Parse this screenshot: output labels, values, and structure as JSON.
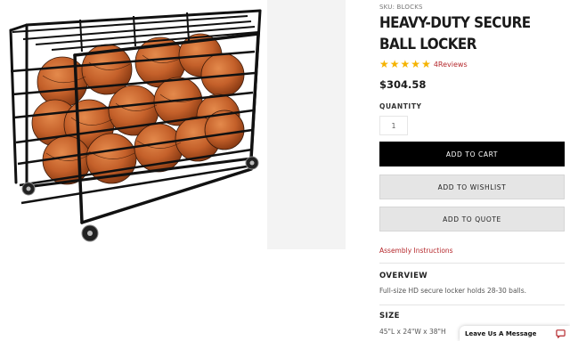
{
  "product": {
    "sku_label": "SKU: BLOCKS",
    "title": "HEAVY-DUTY SECURE BALL LOCKER",
    "rating_stars": 5,
    "reviews_label": "4Reviews",
    "price": "$304.58",
    "quantity_label": "QUANTITY",
    "quantity_value": "1"
  },
  "actions": {
    "add_to_cart": "ADD TO CART",
    "add_to_wishlist": "ADD TO WISHLIST",
    "add_to_quote": "ADD TO QUOTE"
  },
  "links": {
    "assembly": "Assembly Instructions"
  },
  "overview": {
    "heading": "OVERVIEW",
    "text": "Full-size HD secure locker holds 28-30 balls."
  },
  "size": {
    "heading": "SIZE",
    "text": "45\"L x 24\"W x 38\"H"
  },
  "chat": {
    "label": "Leave Us A Message"
  },
  "colors": {
    "accent_red": "#b5282c",
    "star_gold": "#f5b301",
    "cart_button": "#000000",
    "secondary_button": "#e5e5e5"
  },
  "icons": {
    "rating": "star-icon",
    "chat": "chat-bubble-icon"
  }
}
